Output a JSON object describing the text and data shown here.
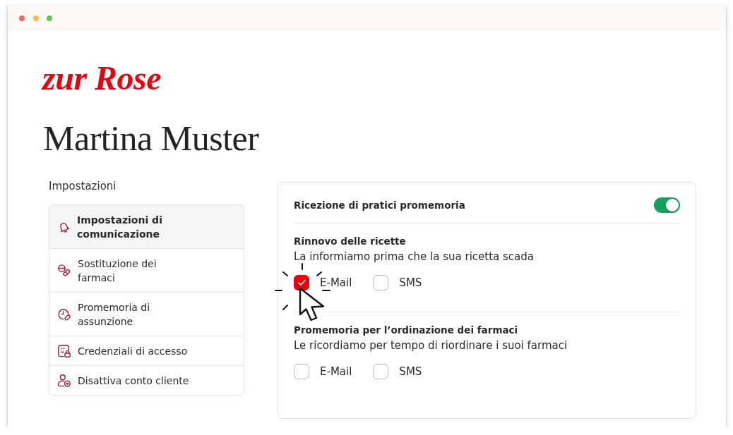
{
  "logo": "zur Rose",
  "page_title": "Martina Muster",
  "sidebar": {
    "heading": "Impostazioni",
    "items": [
      {
        "label": "Impostazioni di comunicazione",
        "selected": true
      },
      {
        "label": "Sostituzione dei farmaci",
        "selected": false
      },
      {
        "label": "Promemoria di assunzione",
        "selected": false
      },
      {
        "label": "Credenziali di accesso",
        "selected": false
      },
      {
        "label": "Disattiva conto cliente",
        "selected": false
      }
    ]
  },
  "panel": {
    "title": "Ricezione di pratici promemoria",
    "toggle": {
      "on": true
    },
    "sections": [
      {
        "title": "Rinnovo delle ricette",
        "description": "La informiamo prima che la sua ricetta scada",
        "options": [
          {
            "label": "E-Mail",
            "checked": true
          },
          {
            "label": "SMS",
            "checked": false
          }
        ]
      },
      {
        "title": "Promemoria per l’ordinazione dei farmaci",
        "description": "Le ricordiamo per tempo di riordinare i suoi farmaci",
        "options": [
          {
            "label": "E-Mail",
            "checked": false
          },
          {
            "label": "SMS",
            "checked": false
          }
        ]
      }
    ]
  }
}
